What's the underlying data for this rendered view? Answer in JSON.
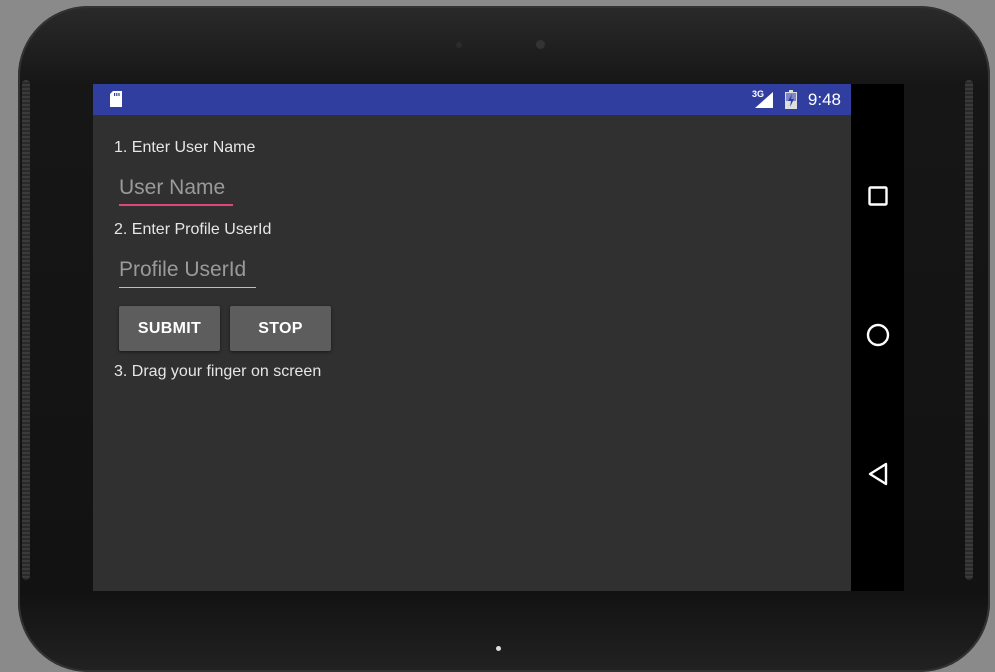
{
  "status_bar": {
    "network": "3G",
    "time": "9:48"
  },
  "form": {
    "step1_label": "1. Enter User Name",
    "username_placeholder": "User Name",
    "step2_label": "2. Enter Profile UserId",
    "profile_placeholder": "Profile UserId",
    "submit_label": "SUBMIT",
    "stop_label": "STOP",
    "step3_label": "3. Drag your finger on screen"
  },
  "nav": {
    "icons": [
      "recents-icon",
      "home-icon",
      "back-icon"
    ]
  },
  "colors": {
    "status_bar": "#303f9f",
    "background": "#303030",
    "accent": "#e0457b",
    "button": "#5d5d5d"
  }
}
